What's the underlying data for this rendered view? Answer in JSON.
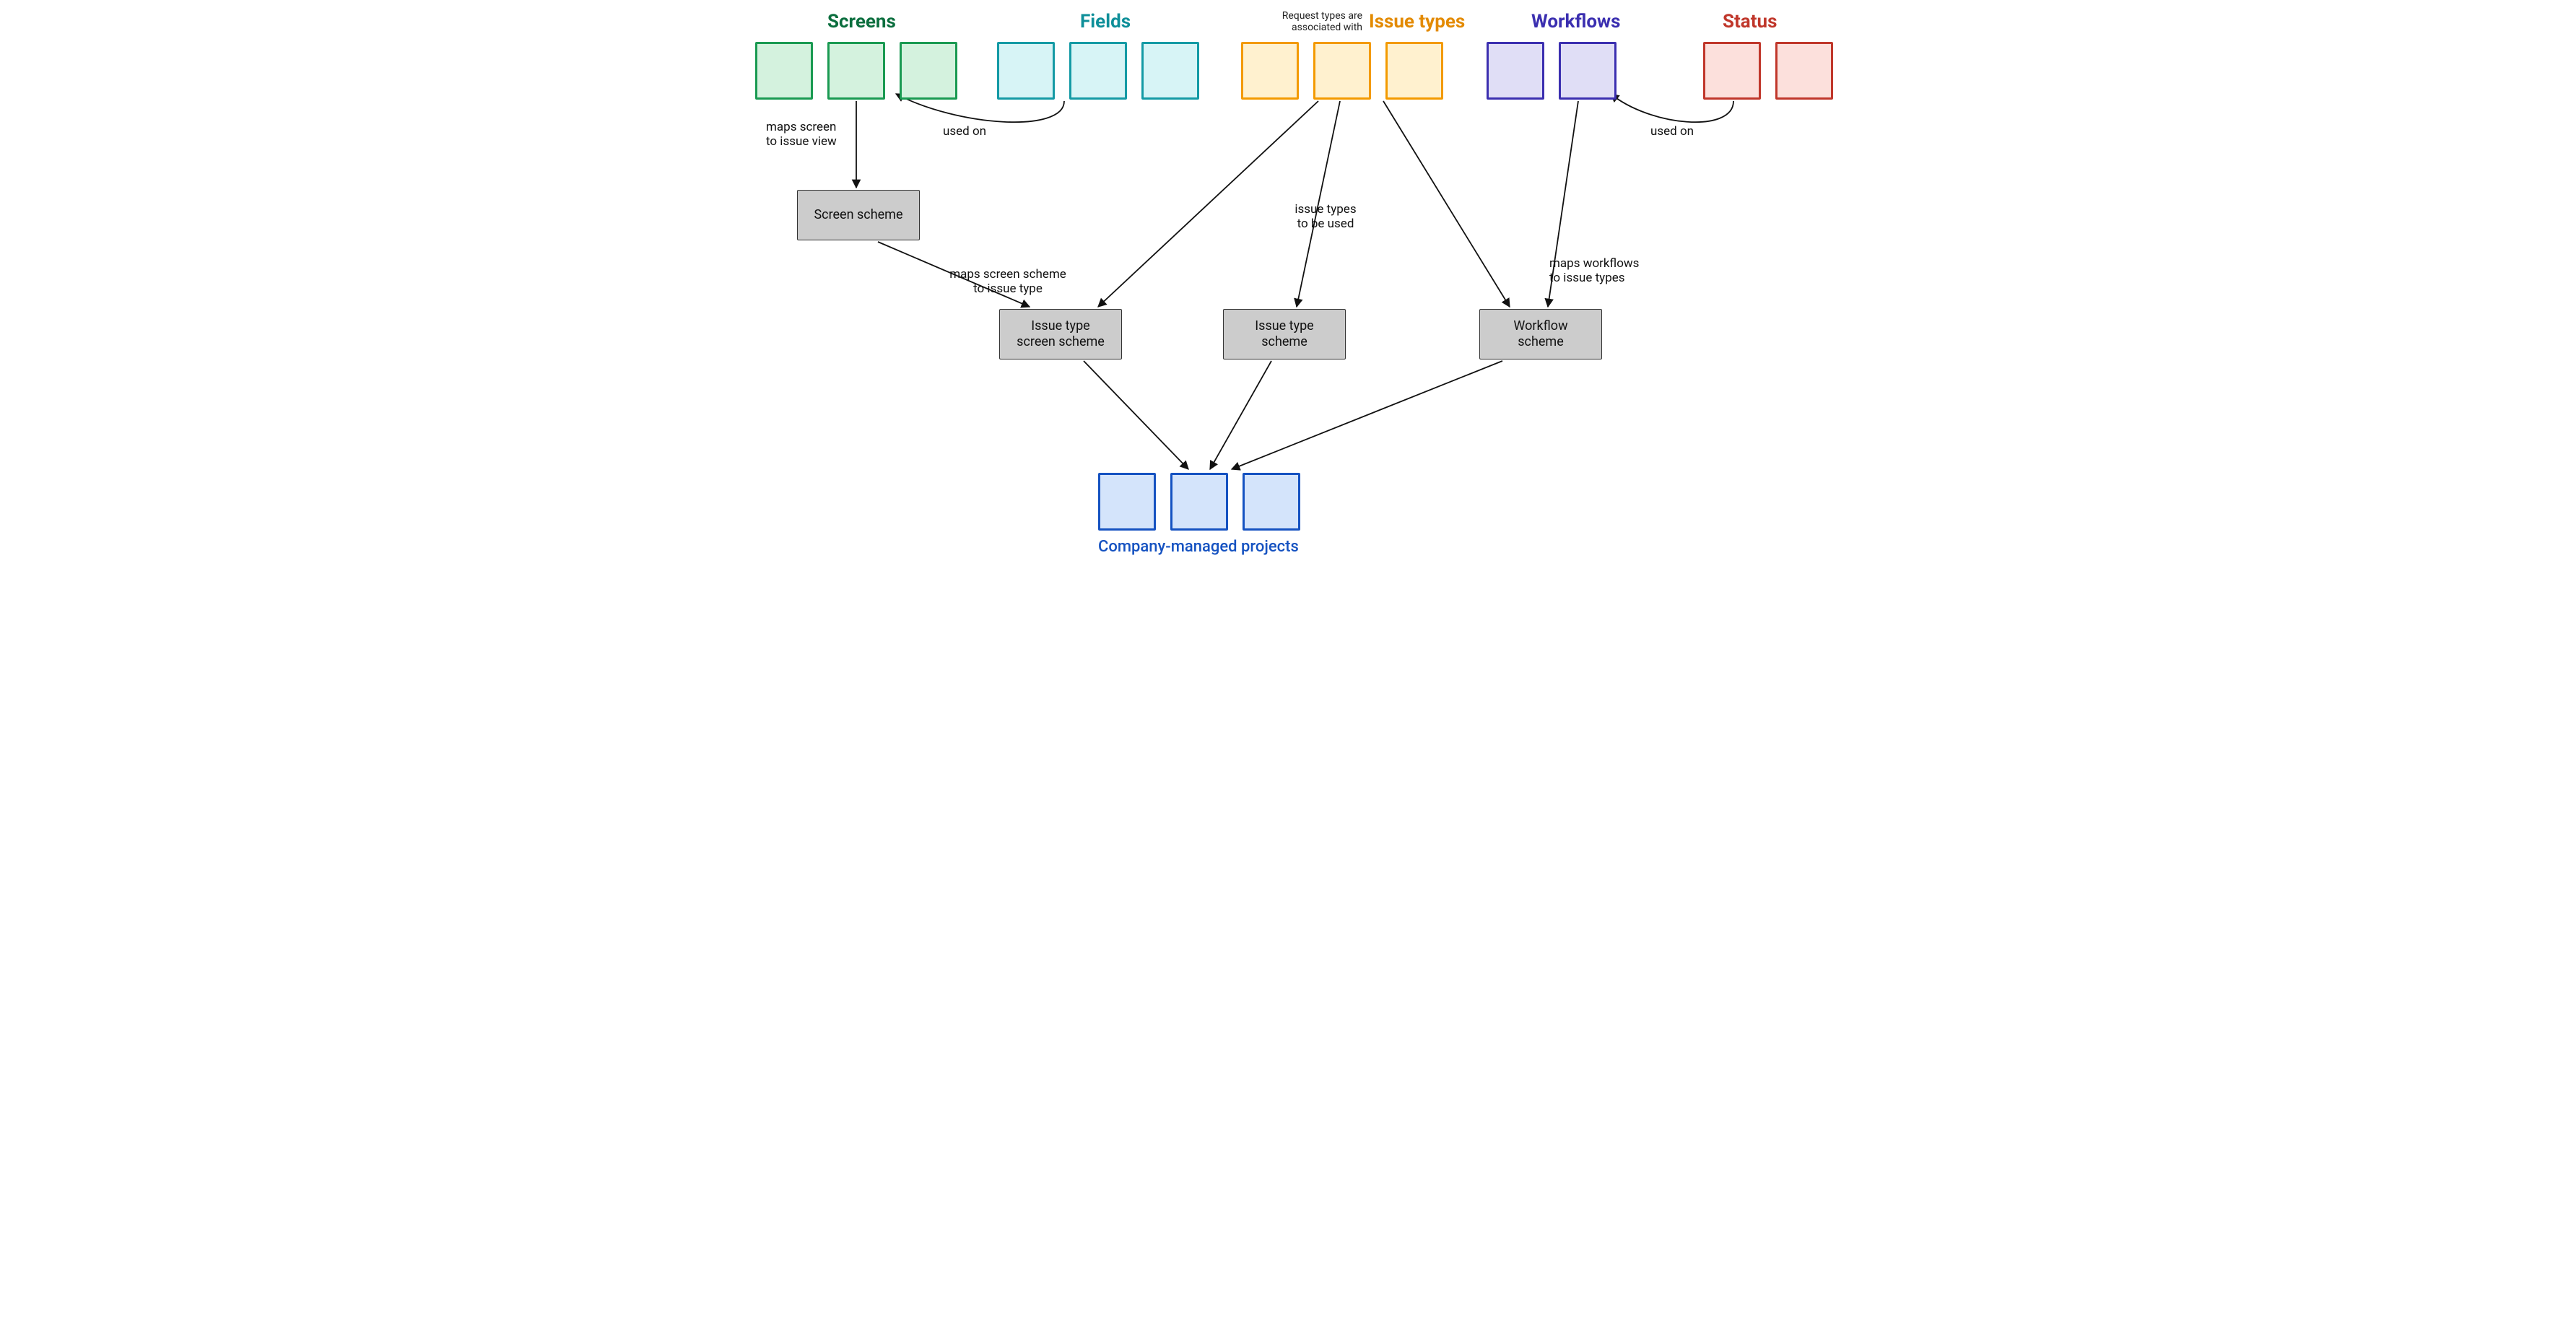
{
  "groups": {
    "screens": {
      "title": "Screens",
      "title_color": "#0b6e3e",
      "border": "#1a9a52",
      "fill": "#d4f2de",
      "count": 3
    },
    "fields": {
      "title": "Fields",
      "title_color": "#0e8f99",
      "border": "#149aa5",
      "fill": "#d7f4f6",
      "count": 3
    },
    "issuetypes": {
      "title": "Issue types",
      "title_color": "#e38a00",
      "border": "#f39a00",
      "fill": "#fff1cf",
      "count": 3,
      "side_note": "Request types are\nassociated with"
    },
    "workflows": {
      "title": "Workflows",
      "title_color": "#3b2fb0",
      "border": "#3b2fb0",
      "fill": "#e0def6",
      "count": 2
    },
    "status": {
      "title": "Status",
      "title_color": "#c0372b",
      "border": "#c0372b",
      "fill": "#fce0dc",
      "count": 2
    },
    "projects": {
      "title": "Company-managed projects",
      "title_color": "#1552c1",
      "border": "#1552c1",
      "fill": "#d4e4fb",
      "count": 3
    }
  },
  "schemes": {
    "screen_scheme": "Screen scheme",
    "issue_type_screen_scheme": "Issue type\nscreen scheme",
    "issue_type_scheme": "Issue type\nscheme",
    "workflow_scheme": "Workflow\nscheme"
  },
  "edges": {
    "screen_to_screen_scheme": "maps screen\nto issue view",
    "field_used_on_screen": "used on",
    "screen_scheme_to_itss": "maps screen scheme\nto issue type",
    "issuetype_to_its": "issue types\nto be used",
    "workflow_to_wfs": "maps workflows\nto issue types",
    "status_used_on_workflow": "used on"
  }
}
